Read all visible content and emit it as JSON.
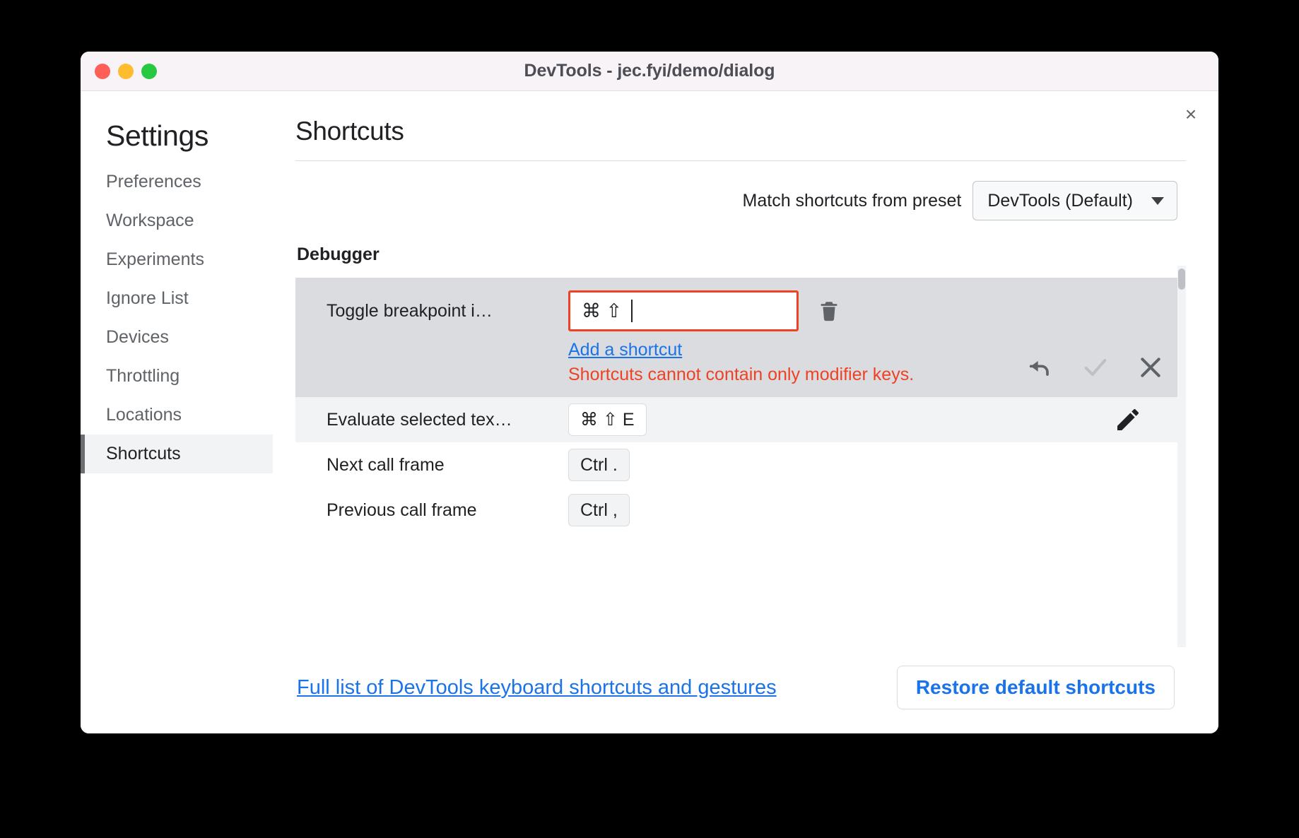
{
  "window": {
    "title": "DevTools - jec.fyi/demo/dialog",
    "traffic_lights": [
      "close",
      "minimize",
      "zoom"
    ],
    "close_icon": "×"
  },
  "sidebar": {
    "title": "Settings",
    "items": [
      {
        "label": "Preferences",
        "selected": false
      },
      {
        "label": "Workspace",
        "selected": false
      },
      {
        "label": "Experiments",
        "selected": false
      },
      {
        "label": "Ignore List",
        "selected": false
      },
      {
        "label": "Devices",
        "selected": false
      },
      {
        "label": "Throttling",
        "selected": false
      },
      {
        "label": "Locations",
        "selected": false
      },
      {
        "label": "Shortcuts",
        "selected": true
      }
    ]
  },
  "main": {
    "title": "Shortcuts",
    "preset": {
      "label": "Match shortcuts from preset",
      "value": "DevTools (Default)",
      "options": [
        "DevTools (Default)"
      ]
    },
    "group": {
      "title": "Debugger",
      "rows": [
        {
          "label": "Toggle breakpoint i…",
          "state": "editing",
          "input_keys": "⌘ ⇧",
          "add_link": "Add a shortcut",
          "error": "Shortcuts cannot contain only modifier keys.",
          "actions": [
            "undo-icon",
            "confirm-icon",
            "cancel-icon"
          ],
          "delete_icon": "trash-icon"
        },
        {
          "label": "Evaluate selected tex…",
          "state": "hovered",
          "shortcut": "⌘ ⇧ E",
          "actions": [
            "edit-icon"
          ]
        },
        {
          "label": "Next call frame",
          "state": "normal",
          "shortcut": "Ctrl ."
        },
        {
          "label": "Previous call frame",
          "state": "normal",
          "shortcut": "Ctrl ,"
        }
      ]
    }
  },
  "footer": {
    "link": "Full list of DevTools keyboard shortcuts and gestures",
    "restore_label": "Restore default shortcuts"
  },
  "colors": {
    "link": "#1a73e8",
    "error": "#ef4123",
    "selected_bg": "#f1f3f4",
    "editing_bg": "#dadce0"
  }
}
